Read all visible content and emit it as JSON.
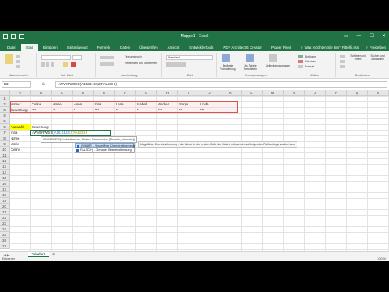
{
  "window": {
    "title": "Mappe1 - Excel",
    "controls": [
      "▭",
      "—",
      "☐",
      "✕"
    ]
  },
  "ribbon_tabs": {
    "items": [
      "Datei",
      "Start",
      "Einfügen",
      "Seitenlayout",
      "Formeln",
      "Daten",
      "Überprüfen",
      "Ansicht",
      "Entwicklertools",
      "PDF Architect 5 Creator",
      "Power Pivot"
    ],
    "active": "Start",
    "tell_me": "♀ Was möchten Sie tun?",
    "user": "Pittelli, Isis",
    "share": "♀ Freigeben"
  },
  "ribbon": {
    "groups": [
      "Zwischenabl...",
      "Schriftart",
      "Ausrichtung",
      "Zahl",
      "Formatvorlagen",
      "Zellen",
      "Bearbeiten"
    ],
    "cmd_wrap": "Textumbruch",
    "cmd_merge": "Verbinden und zentrieren",
    "cmd_standard": "Standard",
    "cmd_cond": "Bedingte Formatierung",
    "cmd_table": "Als Tabelle formatieren",
    "cmd_cellstyles": "Zellenformatvorlagen",
    "cmd_insert": "Einfügen",
    "cmd_delete": "Löschen",
    "cmd_format": "Format",
    "cmd_sort": "Sortieren und Filtern",
    "cmd_find": "Suchen und Auswählen"
  },
  "formula_bar": {
    "name_box": "B3",
    "fx": "fx",
    "formula": "=WVERWEIS(A15;B1:I3;2;FALSCH)"
  },
  "columns": [
    "A",
    "B",
    "C",
    "D",
    "E",
    "F",
    "G",
    "H",
    "I",
    "J",
    "K",
    "L",
    "M",
    "N",
    "O",
    "P",
    "Q",
    "R"
  ],
  "rows": [
    "1",
    "2",
    "3",
    "4",
    "5",
    "6",
    "7",
    "8",
    "9",
    "10",
    "11",
    "12",
    "13",
    "14",
    "15",
    "16",
    "17",
    "18",
    "19",
    "20",
    "21",
    "22",
    "23",
    "24",
    "25",
    "26",
    "27"
  ],
  "sheet": {
    "a2": "Name:",
    "a3": "Bewertung:",
    "names": [
      "Celine",
      "Marie",
      "Anna",
      "Irina",
      "Lena",
      "Isabell",
      "Andrea",
      "Sonja",
      "Linda"
    ],
    "ratings": [
      "***",
      "**",
      "*",
      "***",
      "**",
      "*",
      "***",
      "**",
      "***"
    ],
    "a5": "Auswahl:",
    "b5": "Bewertung:",
    "a6": "Irina",
    "a7": "Name",
    "a8": "Marie",
    "a9": "Celine"
  },
  "editing": {
    "fn": "=WVERWEIS(",
    "ref": "A15;B1:I3",
    "rest": ";2;FALSCH",
    "tooltip": "WVERWEIS(Suchkriterium; Matrix; Zeilenindex; [Bereich_Verweis])",
    "options": [
      "(WAHR) - Ungefähre Übereinstimmung",
      "FALSCH) - Genaue Übereinstimmung"
    ],
    "description": "Ungefähre Übereinstimmung - die Werte in der ersten Zeile der Matrix müssen in aufsteigender Reihenfolge sortiert sein"
  },
  "sheet_tabs": {
    "nav": "◀ ▶",
    "active": "Tabelle1",
    "add": "⊕"
  },
  "status": {
    "mode": "Eingeben",
    "zoom": "100 %"
  }
}
